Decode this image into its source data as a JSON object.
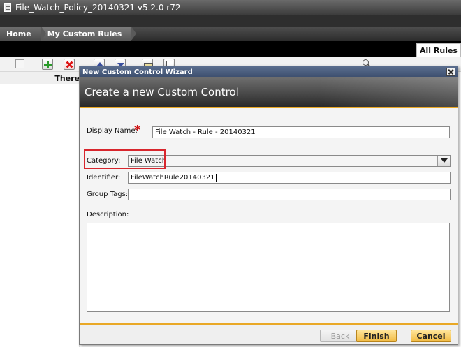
{
  "app": {
    "window_title": "File_Watch_Policy_20140321 v5.2.0 r72",
    "breadcrumbs": [
      "Home",
      "My Custom Rules"
    ],
    "tab_all_rules": "All Rules",
    "list_message": "There"
  },
  "dialog": {
    "title": "New Custom Control Wizard",
    "header": "Create a new Custom Control",
    "display_name_label": "Display Name:",
    "display_name_value": "File Watch - Rule - 20140321",
    "required_mark": "*",
    "category_label": "Category:",
    "category_value": "File Watch",
    "identifier_label": "Identifier:",
    "identifier_value": "FileWatchRule20140321",
    "group_tags_label": "Group Tags:",
    "group_tags_value": "",
    "description_label": "Description:",
    "buttons": {
      "back": "Back",
      "finish": "Finish",
      "cancel": "Cancel"
    }
  },
  "colors": {
    "accent": "#e9a826",
    "highlight": "#d8262d",
    "titlebar": "#4a5d7e"
  }
}
